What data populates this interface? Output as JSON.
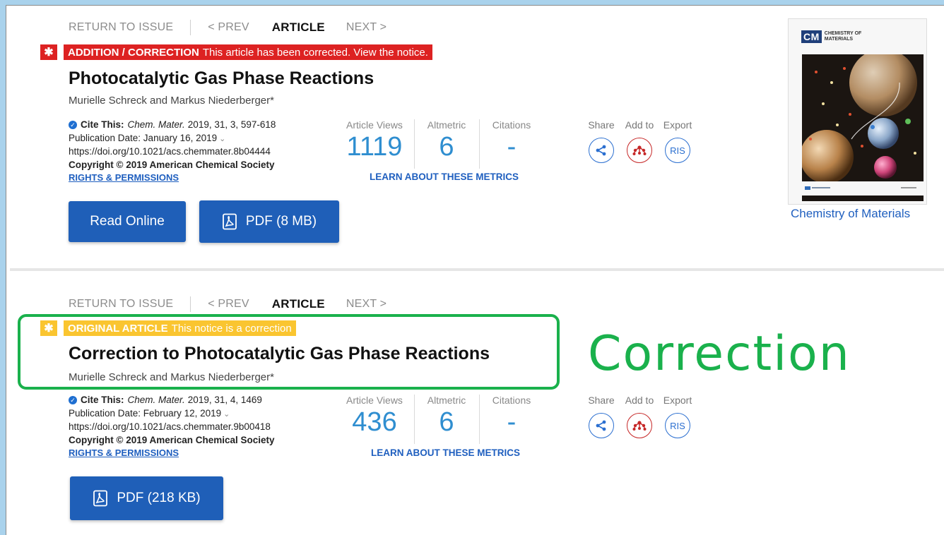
{
  "colors": {
    "accent_blue": "#1f5fb8",
    "metric_blue": "#2f8ed0",
    "notice_red": "#dd2222",
    "notice_yellow": "#fac530",
    "highlight_green": "#1ab14c"
  },
  "articles": [
    {
      "nav": {
        "return": "RETURN TO ISSUE",
        "prev": "< PREV",
        "article": "ARTICLE",
        "next": "NEXT >"
      },
      "notice": {
        "star": "✱",
        "label": "ADDITION / CORRECTION",
        "text": "This article has been corrected. View the notice."
      },
      "title": "Photocatalytic Gas Phase Reactions",
      "authors": "Murielle Schreck and Markus Niederberger*",
      "cite_label": "Cite This:",
      "journal": "Chem. Mater.",
      "cite_rest": "2019, 31, 3, 597-618",
      "pub_date": "Publication Date: January 16, 2019",
      "doi": "https://doi.org/10.1021/acs.chemmater.8b04444",
      "copyright": "Copyright © 2019 American Chemical Society",
      "rights": "RIGHTS & PERMISSIONS",
      "metrics": {
        "views_label": "Article Views",
        "views": "1119",
        "altmetric_label": "Altmetric",
        "altmetric": "6",
        "citations_label": "Citations",
        "citations": "-",
        "learn": "LEARN ABOUT THESE METRICS"
      },
      "actions": {
        "share": "Share",
        "add_to": "Add to",
        "export": "Export",
        "ris": "RIS"
      },
      "buttons": {
        "read_online": "Read Online",
        "pdf": "PDF (8 MB)"
      }
    },
    {
      "nav": {
        "return": "RETURN TO ISSUE",
        "prev": "< PREV",
        "article": "ARTICLE",
        "next": "NEXT >"
      },
      "notice": {
        "star": "✱",
        "label": "ORIGINAL ARTICLE",
        "text": "This notice is a correction"
      },
      "title": "Correction to Photocatalytic Gas Phase Reactions",
      "authors": "Murielle Schreck and Markus Niederberger*",
      "cite_label": "Cite This:",
      "journal": "Chem. Mater.",
      "cite_rest": "2019, 31, 4, 1469",
      "pub_date": "Publication Date: February 12, 2019",
      "doi": "https://doi.org/10.1021/acs.chemmater.9b00418",
      "copyright": "Copyright © 2019 American Chemical Society",
      "rights": "RIGHTS & PERMISSIONS",
      "metrics": {
        "views_label": "Article Views",
        "views": "436",
        "altmetric_label": "Altmetric",
        "altmetric": "6",
        "citations_label": "Citations",
        "citations": "-",
        "learn": "LEARN ABOUT THESE METRICS"
      },
      "actions": {
        "share": "Share",
        "add_to": "Add to",
        "export": "Export",
        "ris": "RIS"
      },
      "buttons": {
        "pdf": "PDF (218 KB)"
      }
    }
  ],
  "cover": {
    "logo_abbr": "CM",
    "logo_name_line1": "CHEMISTRY OF",
    "logo_name_line2": "MATERIALS",
    "caption": "Chemistry of Materials"
  },
  "annotation": {
    "label": "Correction"
  }
}
